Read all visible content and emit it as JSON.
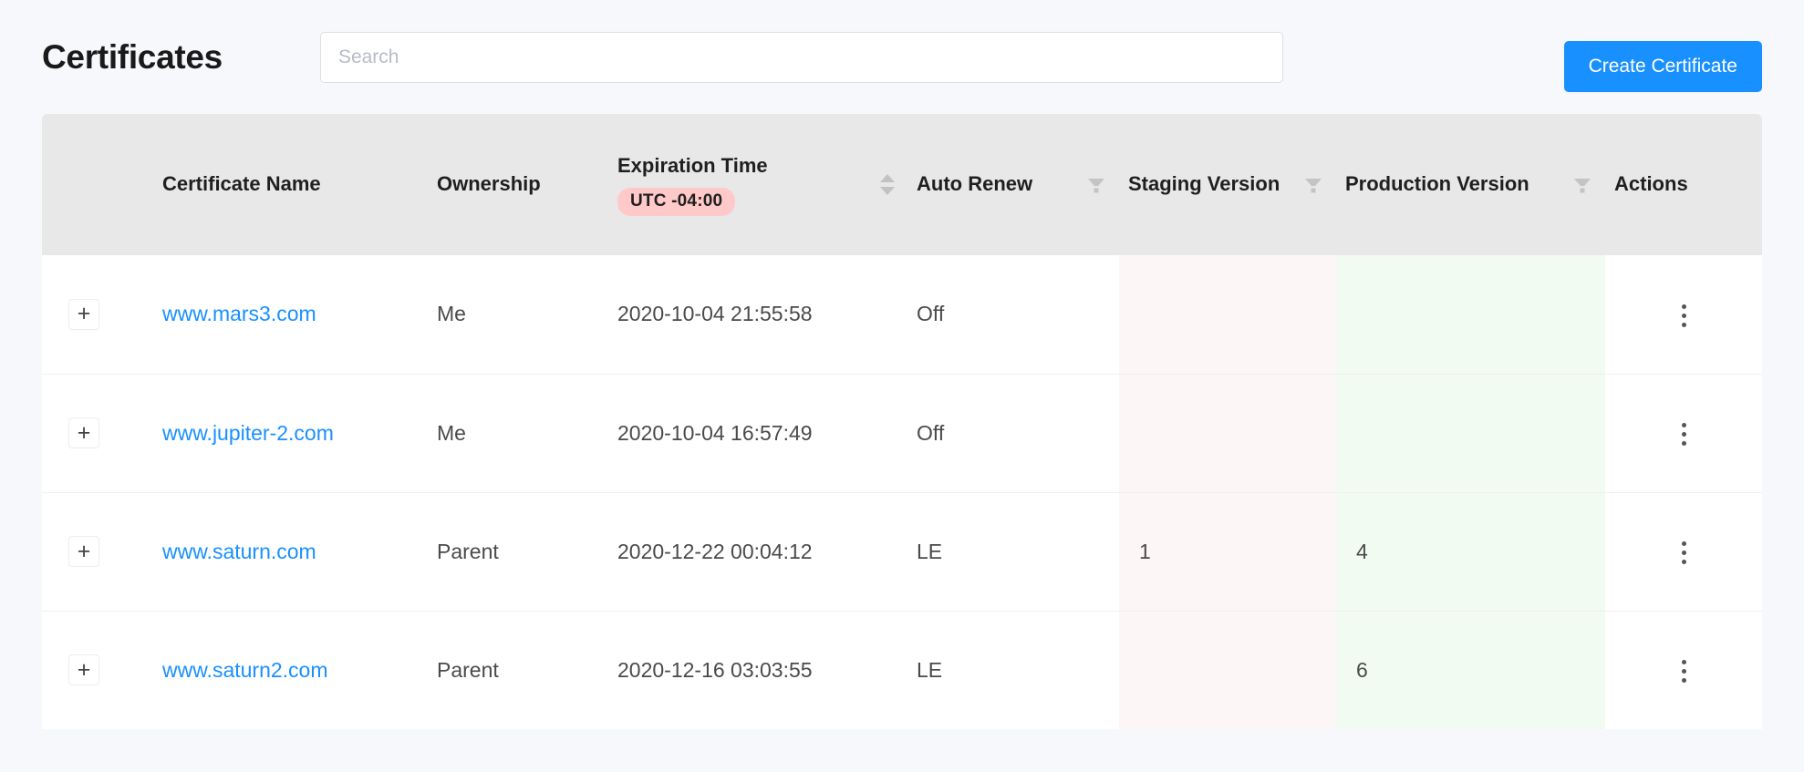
{
  "header": {
    "title": "Certificates",
    "search": {
      "value": "",
      "placeholder": "Search"
    },
    "create_button": "Create Certificate"
  },
  "colors": {
    "accent": "#1890ff",
    "link": "#1890ff",
    "page_background": "#f7f8fc",
    "header_row": "#e8e8e8",
    "timezone_badge": "#ffc9c9",
    "staging_column": "#fdf6f7",
    "production_column": "#f1fbf2"
  },
  "table": {
    "columns": [
      {
        "key": "expand",
        "label": "",
        "icon": null,
        "badge": null
      },
      {
        "key": "name",
        "label": "Certificate Name",
        "icon": null,
        "badge": null
      },
      {
        "key": "ownership",
        "label": "Ownership",
        "icon": null,
        "badge": null
      },
      {
        "key": "expiration",
        "label": "Expiration Time",
        "icon": "sort-icon",
        "badge": "UTC -04:00"
      },
      {
        "key": "autorenew",
        "label": "Auto Renew",
        "icon": "filter-icon",
        "badge": null
      },
      {
        "key": "staging",
        "label": "Staging Version",
        "icon": "filter-icon",
        "badge": null
      },
      {
        "key": "production",
        "label": "Production Version",
        "icon": "filter-icon",
        "badge": null
      },
      {
        "key": "actions",
        "label": "Actions",
        "icon": null,
        "badge": null
      }
    ],
    "expand_label": "+",
    "rows": [
      {
        "name": "www.mars3.com",
        "ownership": "Me",
        "expiration": "2020-10-04 21:55:58",
        "autorenew": "Off",
        "staging": "",
        "production": ""
      },
      {
        "name": "www.jupiter-2.com",
        "ownership": "Me",
        "expiration": "2020-10-04 16:57:49",
        "autorenew": "Off",
        "staging": "",
        "production": ""
      },
      {
        "name": "www.saturn.com",
        "ownership": "Parent",
        "expiration": "2020-12-22 00:04:12",
        "autorenew": "LE",
        "staging": "1",
        "production": "4"
      },
      {
        "name": "www.saturn2.com",
        "ownership": "Parent",
        "expiration": "2020-12-16 03:03:55",
        "autorenew": "LE",
        "staging": "",
        "production": "6"
      }
    ]
  }
}
